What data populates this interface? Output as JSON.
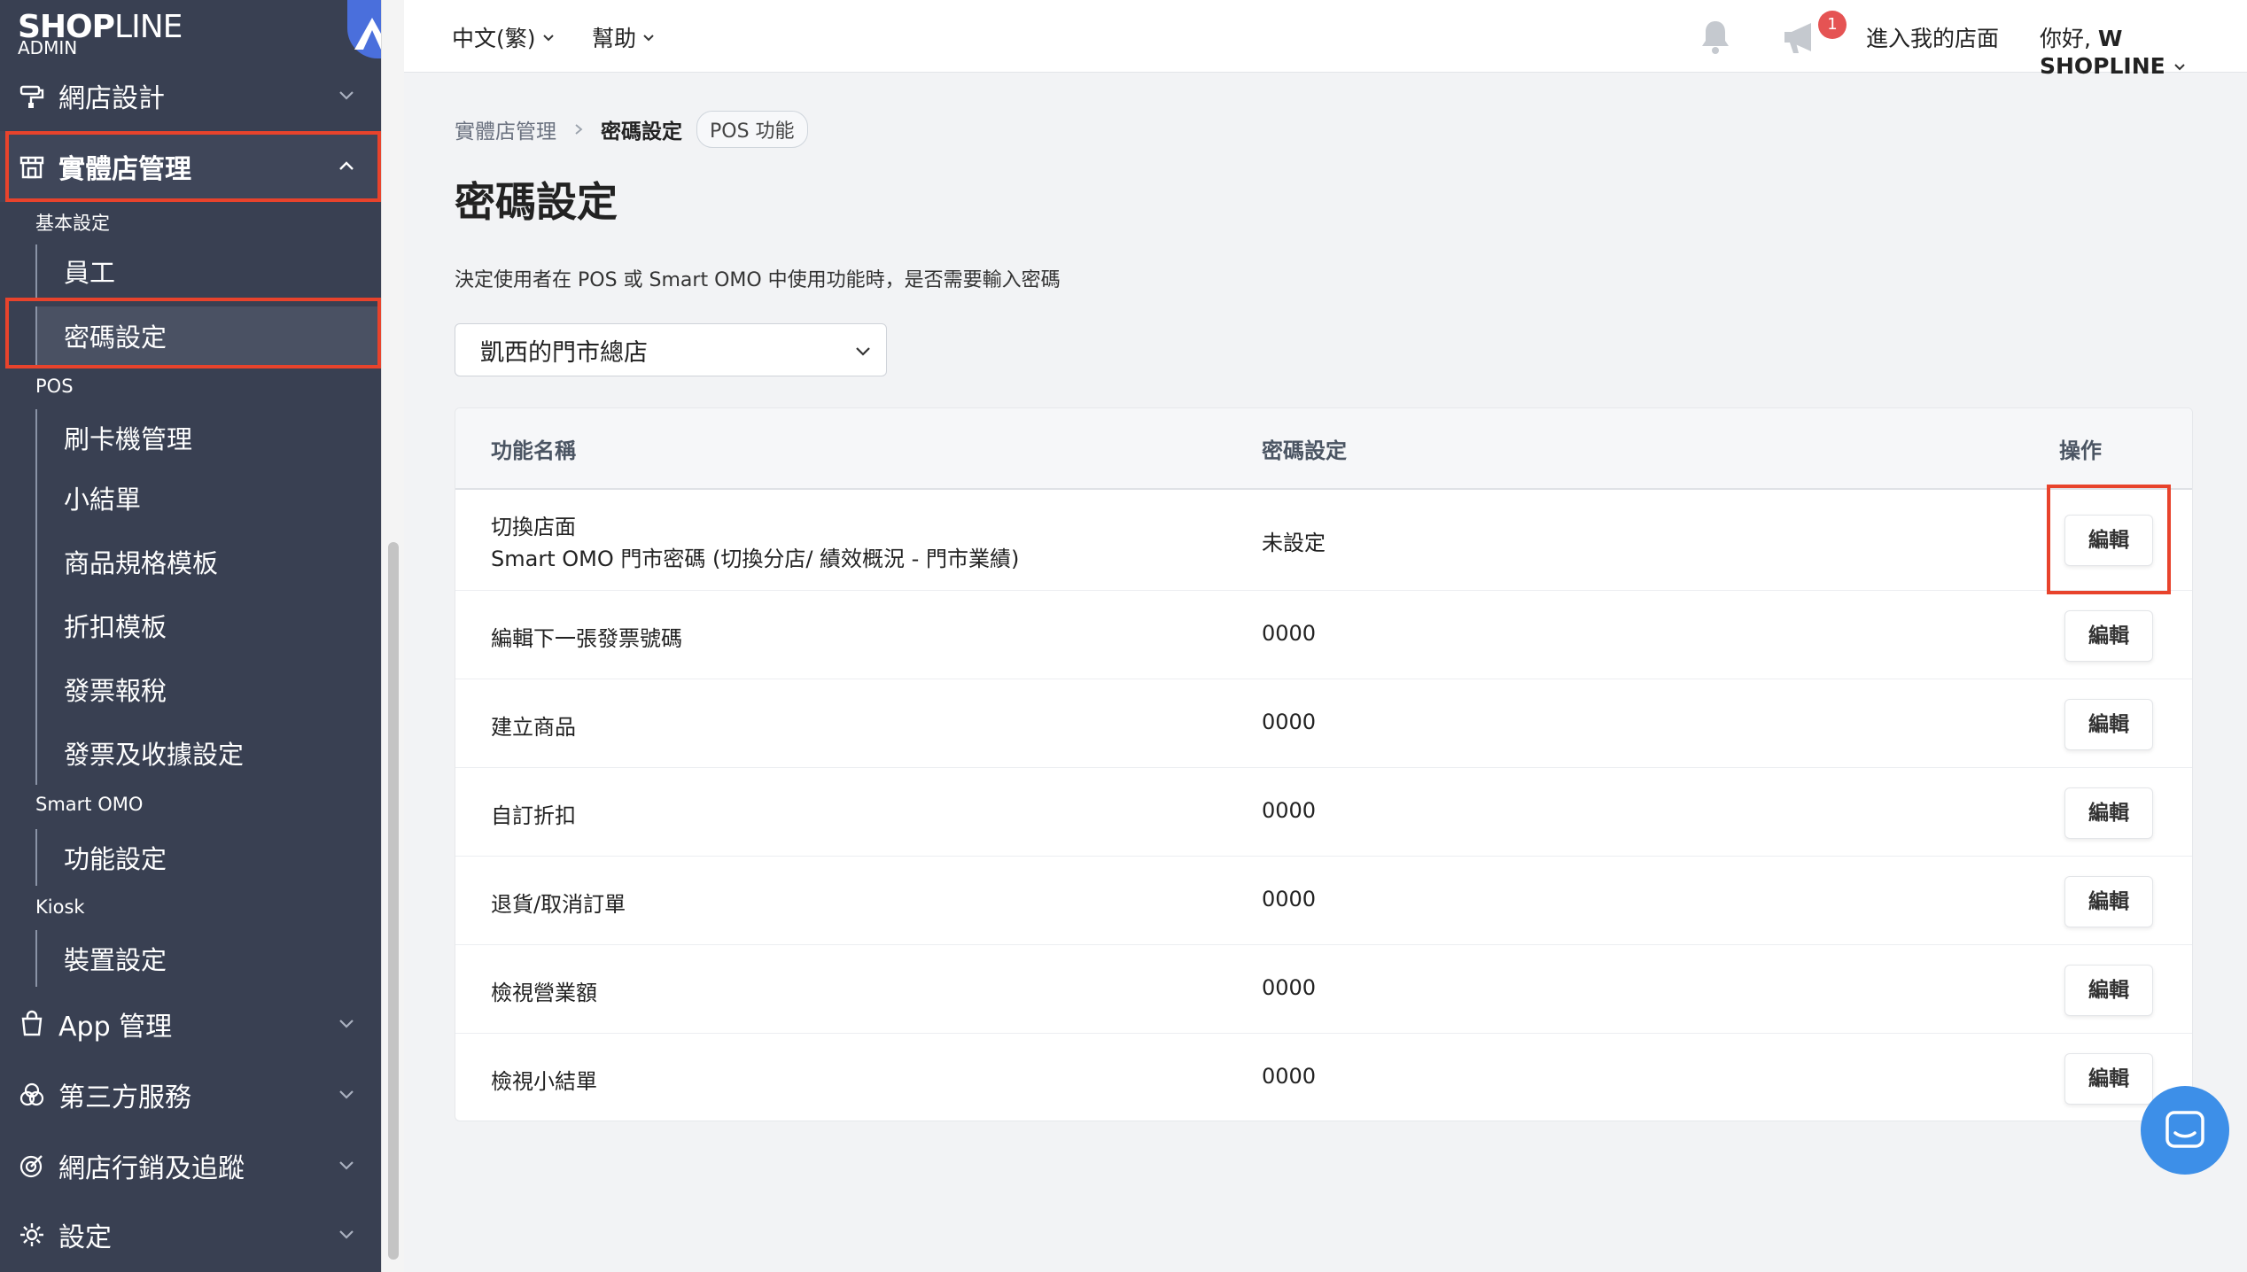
{
  "app": {
    "brand": "SHOPLINE",
    "brand_bold": "SHOP",
    "brand_light": "LINE",
    "brand_sub": "ADMIN"
  },
  "sidebar": {
    "items": [
      {
        "label": "網店設計",
        "icon": "paint-roller-icon"
      },
      {
        "label": "實體店管理",
        "icon": "store-icon",
        "expanded": true
      },
      {
        "label": "App 管理",
        "icon": "shopping-bag-icon"
      },
      {
        "label": "第三方服務",
        "icon": "circles-icon"
      },
      {
        "label": "網店行銷及追蹤",
        "icon": "target-icon"
      },
      {
        "label": "設定",
        "icon": "gear-icon"
      }
    ],
    "sections": {
      "basic": {
        "label": "基本設定",
        "items": [
          "員工",
          "密碼設定"
        ]
      },
      "pos": {
        "label": "POS",
        "items": [
          "刷卡機管理",
          "小結單",
          "商品規格模板",
          "折扣模板",
          "發票報稅",
          "發票及收據設定"
        ]
      },
      "omo": {
        "label": "Smart OMO",
        "items": [
          "功能設定"
        ]
      },
      "kiosk": {
        "label": "Kiosk",
        "items": [
          "裝置設定"
        ]
      }
    },
    "active_item": "密碼設定"
  },
  "header": {
    "language": "中文(繁)",
    "help": "幫助",
    "notification_count": "1",
    "visit_store": "進入我的店面",
    "greeting_prefix": "你好, ",
    "user_name": "W SHOPLINE"
  },
  "breadcrumb": {
    "parent": "實體店管理",
    "current": "密碼設定",
    "tag": "POS 功能"
  },
  "page": {
    "title": "密碼設定",
    "description": "決定使用者在 POS 或 Smart OMO 中使用功能時，是否需要輸入密碼",
    "store_select": "凱西的門市總店"
  },
  "table": {
    "headers": {
      "name": "功能名稱",
      "password": "密碼設定",
      "action": "操作"
    },
    "edit_label": "編輯",
    "rows": [
      {
        "name": "切換店面",
        "name_sub": "Smart OMO 門市密碼 (切換分店/ 績效概況 - 門市業績)",
        "password": "未設定"
      },
      {
        "name": "編輯下一張發票號碼",
        "password": "0000"
      },
      {
        "name": "建立商品",
        "password": "0000"
      },
      {
        "name": "自訂折扣",
        "password": "0000"
      },
      {
        "name": "退貨/取消訂單",
        "password": "0000"
      },
      {
        "name": "檢視營業額",
        "password": "0000"
      },
      {
        "name": "檢視小結單",
        "password": "0000"
      }
    ]
  },
  "colors": {
    "sidebar_bg": "#394052",
    "highlight": "#e8432c",
    "accent": "#4a6fdc",
    "badge": "#e55353",
    "chat": "#3d8fe8"
  }
}
